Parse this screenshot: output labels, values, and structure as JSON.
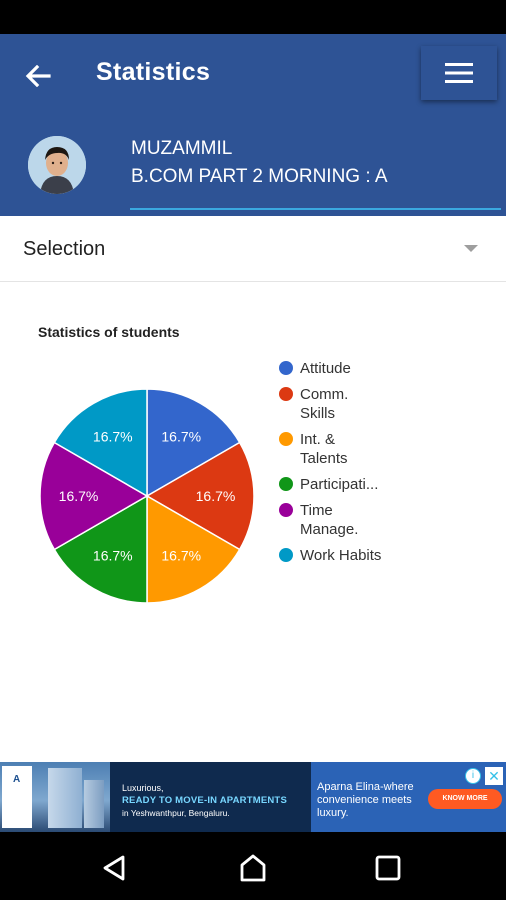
{
  "header": {
    "title": "Statistics",
    "student_name": "MUZAMMIL",
    "student_class": "B.COM PART 2 MORNING : A"
  },
  "selection": {
    "label": "Selection"
  },
  "chart_data": {
    "type": "pie",
    "title": "Statistics of students",
    "categories": [
      "Attitude",
      "Comm. Skills",
      "Int. & Talents",
      "Participati...",
      "Time Manage.",
      "Work Habits"
    ],
    "values": [
      16.7,
      16.7,
      16.7,
      16.7,
      16.7,
      16.7
    ],
    "value_labels": [
      "16.7%",
      "16.7%",
      "16.7%",
      "16.7%",
      "16.7%",
      "16.7%"
    ],
    "legend_lines": [
      [
        "Attitude"
      ],
      [
        "Comm.",
        "Skills"
      ],
      [
        "Int. &",
        "Talents"
      ],
      [
        "Participati..."
      ],
      [
        "Time",
        "Manage."
      ],
      [
        "Work Habits"
      ]
    ],
    "colors": [
      "#3366cc",
      "#dc3912",
      "#ff9900",
      "#109618",
      "#990099",
      "#0099c6"
    ],
    "legend_position": "right"
  },
  "ad": {
    "small_text": "Luxurious,",
    "headline": "READY TO MOVE-IN APARTMENTS",
    "sub_text": "in Yeshwanthpur, Bengaluru.",
    "right_text": "Aparna Elina-where convenience meets luxury.",
    "cta_label": "KNOW MORE",
    "info_icon": "i",
    "close_icon": "✕"
  },
  "colors": {
    "header_bg": "#2e5395",
    "accent_line": "#3aa8e0"
  }
}
